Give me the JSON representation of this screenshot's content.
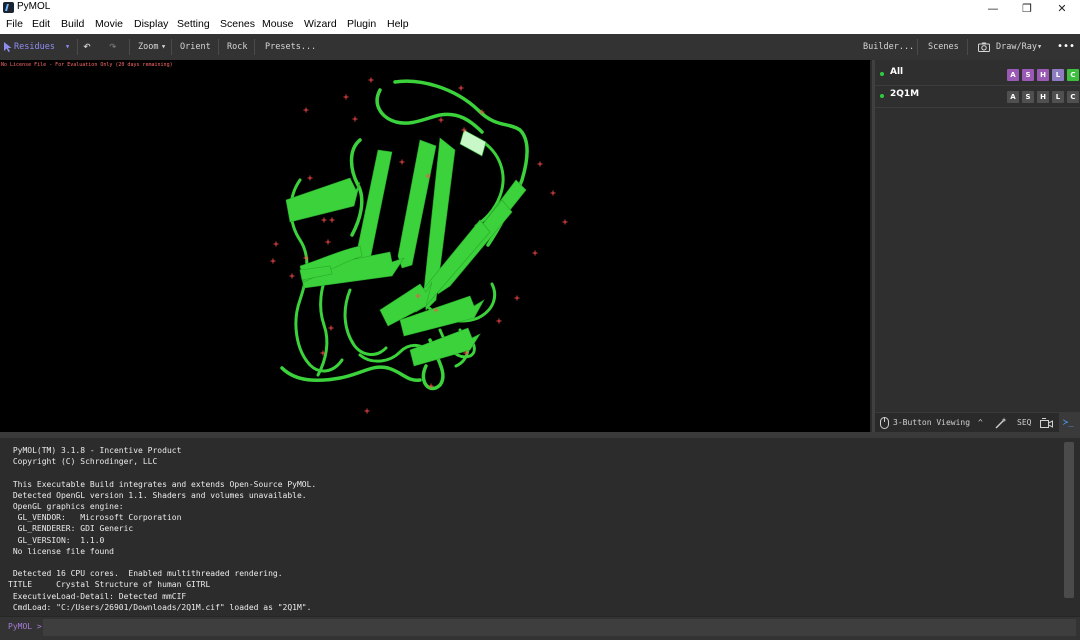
{
  "window": {
    "title": "PyMOL",
    "minimize_glyph": "—",
    "maximize_glyph": "❐",
    "close_glyph": "✕"
  },
  "menu": [
    "File",
    "Edit",
    "Build",
    "Movie",
    "Display",
    "Setting",
    "Scenes",
    "Mouse",
    "Wizard",
    "Plugin",
    "Help"
  ],
  "toolbar": {
    "mode_label": "Residues",
    "mode_arrow": "▾",
    "undo_glyph": "↶",
    "redo_glyph": "↷",
    "zoom_label": "Zoom",
    "zoom_arrow": "▾",
    "orient_label": "Orient",
    "rock_label": "Rock",
    "presets_label": "Presets...",
    "builder_label": "Builder...",
    "scenes_label": "Scenes",
    "drawray_label": "Draw/Ray",
    "drawray_arrow": "▾",
    "more_glyph": "•••"
  },
  "viewport": {
    "license_notice": "No License File - For Evaluation Only (20 days remaining)",
    "background": "#000000",
    "ribbon_color": "#3bd23b",
    "marker_color": "#ff4d4d"
  },
  "objects": [
    {
      "name": "All",
      "buttons": [
        "A",
        "S",
        "H",
        "L",
        "C"
      ],
      "colors": [
        "#9b59b6",
        "#9b59b6",
        "#9b59b6",
        "#8e7cc3",
        "#3fbf3f"
      ]
    },
    {
      "name": "2Q1M",
      "buttons": [
        "A",
        "S",
        "H",
        "L",
        "C"
      ],
      "colors": [
        "#505050",
        "#505050",
        "#505050",
        "#505050",
        "#505050"
      ]
    }
  ],
  "panel_bottom": {
    "viewing_label": "3-Button Viewing",
    "viewing_arrow": "^",
    "seq_label": "SEQ",
    "prompt_glyph": "≻_"
  },
  "console_lines": [
    " PyMOL(TM) 3.1.8 - Incentive Product",
    " Copyright (C) Schrodinger, LLC",
    "",
    " This Executable Build integrates and extends Open-Source PyMOL.",
    " Detected OpenGL version 1.1. Shaders and volumes unavailable.",
    " OpenGL graphics engine:",
    "  GL_VENDOR:   Microsoft Corporation",
    "  GL_RENDERER: GDI Generic",
    "  GL_VERSION:  1.1.0",
    " No license file found",
    "",
    " Detected 16 CPU cores.  Enabled multithreaded rendering.",
    "TITLE     Crystal Structure of human GITRL",
    " ExecutiveLoad-Detail: Detected mmCIF",
    " CmdLoad: \"C:/Users/26901/Downloads/2Q1M.cif\" loaded as \"2Q1M\"."
  ],
  "command": {
    "prompt": "PyMOL >",
    "value": "",
    "placeholder": ""
  }
}
